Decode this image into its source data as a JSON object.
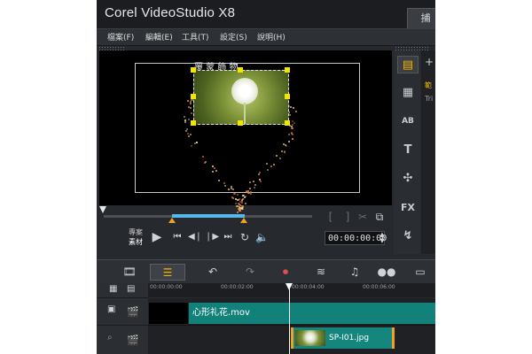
{
  "app": {
    "title": "Corel  VideoStudio X8",
    "tab_label": "捕"
  },
  "menu": [
    "檔案(F)",
    "編輯(E)",
    "工具(T)",
    "設定(S)",
    "說明(H)"
  ],
  "preview": {
    "overlay_text": "覆 蒙 飾 物"
  },
  "player": {
    "project_label": "專案",
    "clip_label": "素材",
    "timecode": "00:00:00:00",
    "bracket_in": "[",
    "bracket_out": "]"
  },
  "tools": {
    "fx_label": "FX",
    "text_label": "T",
    "ab_label": "AB"
  },
  "right_panel": {
    "plus": "+",
    "line1": "範",
    "line2": "Tri"
  },
  "ruler": {
    "ticks": [
      "00:00:00:00",
      "00:00:02:00",
      "00:00:04:00",
      "00:00:06:00"
    ]
  },
  "tracks": {
    "video_clip": "心形礼花.mov",
    "overlay_clip": "SP-I01.jpg"
  },
  "colors": {
    "accent_teal": "#11817a",
    "scrub_blue": "#55b8e8",
    "handle_yellow": "#f2e600",
    "trim_orange": "#f2a020"
  }
}
